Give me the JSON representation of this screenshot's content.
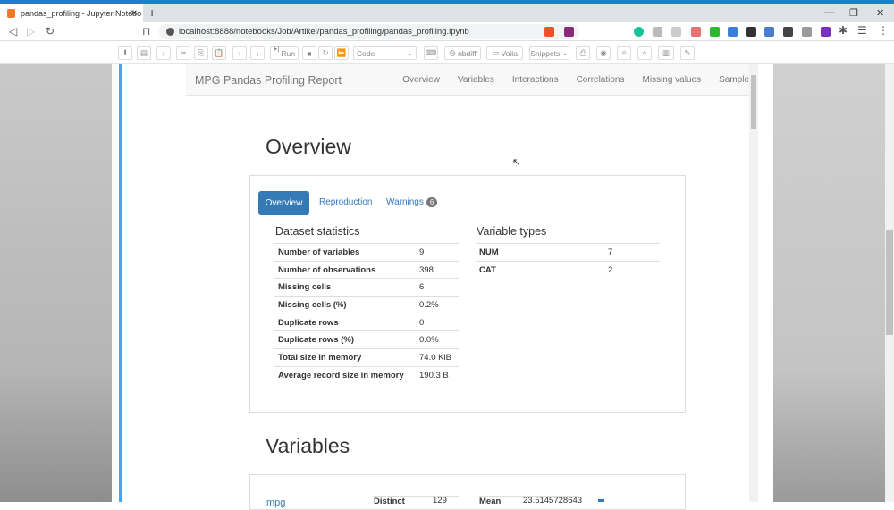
{
  "browser": {
    "tab_title": "pandas_profiling - Jupyter Notebo",
    "url": "localhost:8888/notebooks/Job/Artikel/pandas_profiling/pandas_profiling.ipynb"
  },
  "toolbar": {
    "run": "Run",
    "cell_type": "Code",
    "nbdiff": "nbdiff",
    "voila": "Voila",
    "snippets": "Snippets"
  },
  "report": {
    "brand": "MPG Pandas Profiling Report",
    "nav": [
      "Overview",
      "Variables",
      "Interactions",
      "Correlations",
      "Missing values",
      "Sample"
    ]
  },
  "overview": {
    "title": "Overview",
    "tabs": [
      "Overview",
      "Reproduction",
      "Warnings"
    ],
    "warnings_count": "6",
    "dataset_title": "Dataset statistics",
    "dataset": [
      [
        "Number of variables",
        "9"
      ],
      [
        "Number of observations",
        "398"
      ],
      [
        "Missing cells",
        "6"
      ],
      [
        "Missing cells (%)",
        "0.2%"
      ],
      [
        "Duplicate rows",
        "0"
      ],
      [
        "Duplicate rows (%)",
        "0.0%"
      ],
      [
        "Total size in memory",
        "74.0 KiB"
      ],
      [
        "Average record size in memory",
        "190.3 B"
      ]
    ],
    "types_title": "Variable types",
    "types": [
      [
        "NUM",
        "7"
      ],
      [
        "CAT",
        "2"
      ]
    ]
  },
  "variables": {
    "title": "Variables",
    "first": {
      "name": "mpg",
      "distinct_label": "Distinct",
      "distinct": "129",
      "mean_label": "Mean",
      "mean": "23.5145728643"
    }
  }
}
